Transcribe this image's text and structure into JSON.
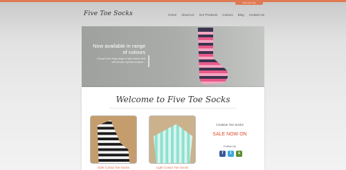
{
  "header": {
    "cart_label": "View your cart",
    "logo_text": "Five Toe Socks",
    "nav": [
      "Home",
      "About Us",
      "Our Products",
      "Colours",
      "Blog",
      "Contact Us"
    ]
  },
  "slider": {
    "heading": "Now available in range of colours",
    "subtext": "Choose from stripy range or light colours that will suit your special occasion..."
  },
  "welcome": {
    "title": "Welcome to Five Toe Socks"
  },
  "products": [
    {
      "caption": "Dark Colour Toe Socks"
    },
    {
      "caption": "Light Colour Toe Socks"
    }
  ],
  "sidebar": {
    "title": "Creative Toe Socks",
    "sale": "SALE NOW ON",
    "follow": "Follow Us"
  },
  "social": [
    {
      "icon": "facebook-icon",
      "glyph": "f"
    },
    {
      "icon": "twitter-icon",
      "glyph": "t"
    },
    {
      "icon": "stumbleupon-icon",
      "glyph": "s"
    }
  ],
  "colors": {
    "accent": "#e07a52",
    "sale": "#e04a2a"
  }
}
